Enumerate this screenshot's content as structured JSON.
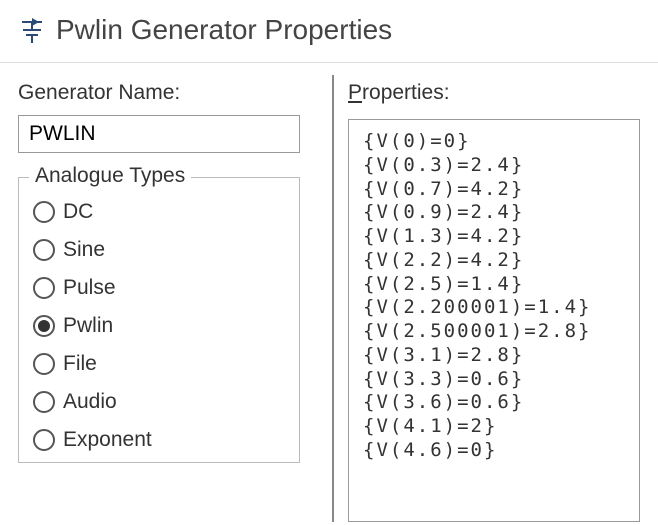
{
  "window": {
    "title": "Pwlin Generator Properties"
  },
  "generator": {
    "name_label": "Generator Name:",
    "name_value": "PWLIN"
  },
  "analogue_types": {
    "legend": "Analogue Types",
    "options": [
      {
        "label": "DC",
        "selected": false
      },
      {
        "label": "Sine",
        "selected": false
      },
      {
        "label": "Pulse",
        "selected": false
      },
      {
        "label": "Pwlin",
        "selected": true
      },
      {
        "label": "File",
        "selected": false
      },
      {
        "label": "Audio",
        "selected": false
      },
      {
        "label": "Exponent",
        "selected": false
      }
    ]
  },
  "properties": {
    "label_prefix": "P",
    "label_rest": "roperties:",
    "lines": [
      "{V(0)=0}",
      "{V(0.3)=2.4}",
      "{V(0.7)=4.2}",
      "{V(0.9)=2.4}",
      "{V(1.3)=4.2}",
      "{V(2.2)=4.2}",
      "{V(2.5)=1.4}",
      "{V(2.200001)=1.4}",
      "{V(2.500001)=2.8}",
      "{V(3.1)=2.8}",
      "{V(3.3)=0.6}",
      "{V(3.6)=0.6}",
      "{V(4.1)=2}",
      "{V(4.6)=0}"
    ]
  }
}
